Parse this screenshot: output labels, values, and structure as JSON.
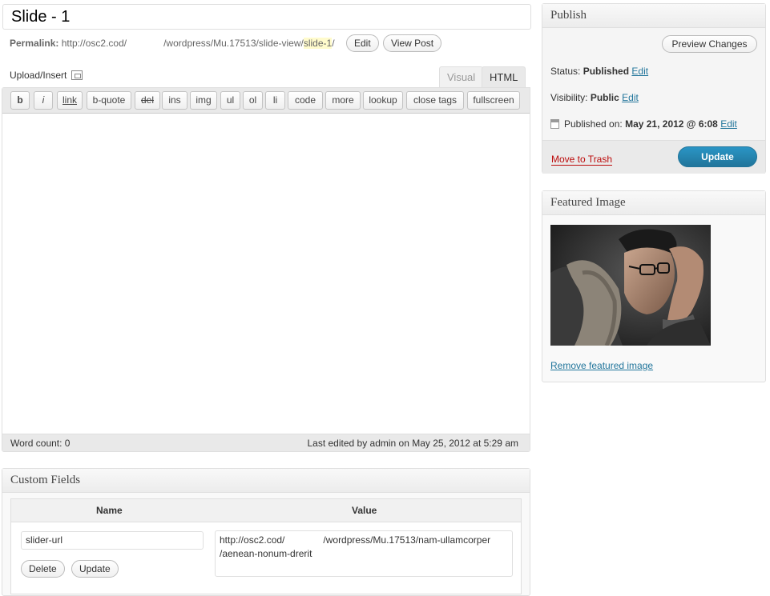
{
  "post": {
    "title": "Slide - 1"
  },
  "permalink": {
    "label": "Permalink:",
    "url_start": "http://osc2.cod/",
    "url_path": "/wordpress/Mu.17513/slide-view/",
    "slug": "slide-1",
    "trailing_slash": "/",
    "edit_label": "Edit",
    "view_post_label": "View Post"
  },
  "editor": {
    "upload_insert_label": "Upload/Insert",
    "tabs": [
      "Visual",
      "HTML"
    ],
    "active_tab": "HTML",
    "quicktags": [
      "b",
      "i",
      "link",
      "b-quote",
      "del",
      "ins",
      "img",
      "ul",
      "ol",
      "li",
      "code",
      "more",
      "lookup",
      "close tags",
      "fullscreen"
    ],
    "content": "",
    "word_count": "Word count: 0",
    "last_edited": "Last edited by admin on May 25, 2012 at 5:29 am"
  },
  "custom_fields": {
    "heading": "Custom Fields",
    "col_name": "Name",
    "col_value": "Value",
    "row": {
      "name": "slider-url",
      "value_line1_start": "http://osc2.cod/",
      "value_line1_end": "/wordpress/Mu.17513/nam-ullamcorper",
      "value_line2": "/aenean-nonum-drerit",
      "delete_label": "Delete",
      "update_label": "Update"
    }
  },
  "publish": {
    "heading": "Publish",
    "preview_label": "Preview Changes",
    "status_label": "Status:",
    "status_value": "Published",
    "visibility_label": "Visibility:",
    "visibility_value": "Public",
    "published_on_label": "Published on:",
    "published_on_value": "May 21, 2012 @ 6:08",
    "edit_label": "Edit",
    "move_to_trash": "Move to Trash",
    "update_label": "Update"
  },
  "featured_image": {
    "heading": "Featured Image",
    "remove_label": "Remove featured image"
  },
  "colors": {
    "link": "#21759b",
    "trash": "#bc0b0b",
    "primary_button": "#21759b",
    "slug_highlight": "#fffbcc"
  }
}
